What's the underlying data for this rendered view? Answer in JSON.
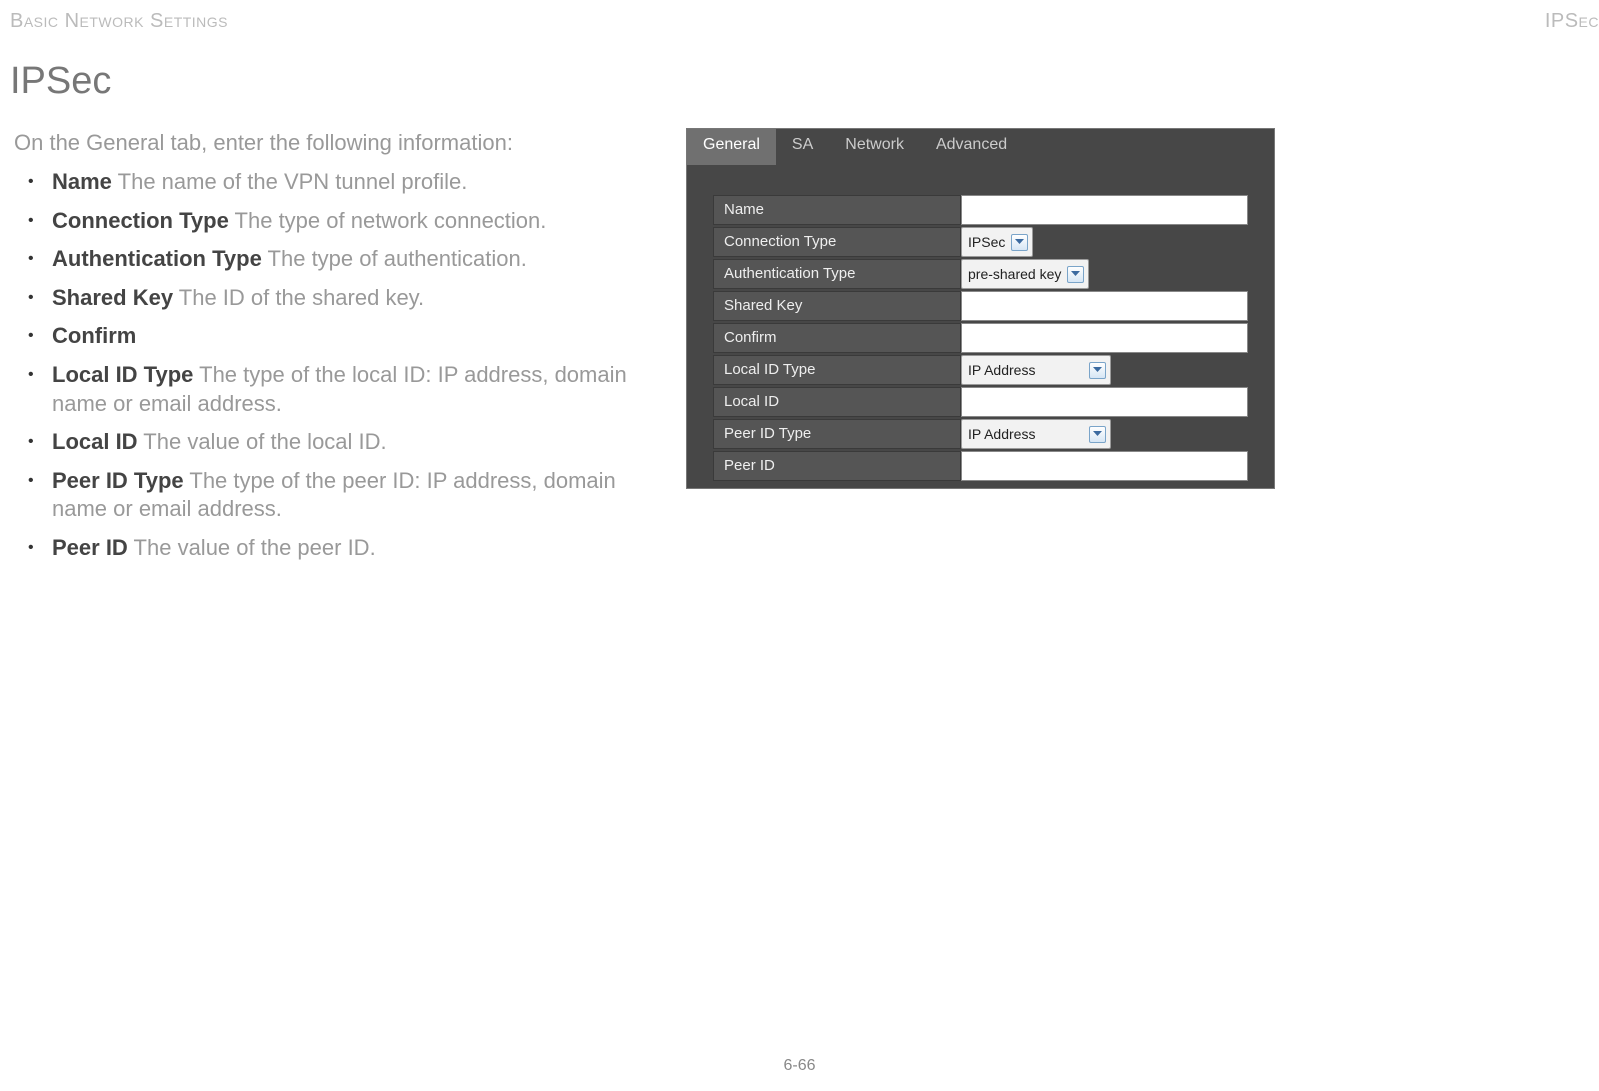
{
  "header": {
    "left": "Basic Network Settings",
    "right": "IPSec"
  },
  "section_title": "IPSec",
  "intro": "On the General tab, enter the following information:",
  "bullets": [
    {
      "term": "Name",
      "desc": "The name of the VPN tunnel profile."
    },
    {
      "term": "Connection Type",
      "desc": "The type of network connection."
    },
    {
      "term": "Authentication Type",
      "desc": "The type of authentication."
    },
    {
      "term": "Shared Key",
      "desc": "The ID of the shared key."
    },
    {
      "term": "Confirm",
      "desc": ""
    },
    {
      "term": "Local ID Type",
      "desc": "The type of the local ID: IP address, domain name or email address."
    },
    {
      "term": "Local ID",
      "desc": "The value of the local ID."
    },
    {
      "term": "Peer ID Type",
      "desc": "The type of the peer ID: IP address, domain name or email address."
    },
    {
      "term": "Peer ID",
      "desc": "The value of the peer ID."
    }
  ],
  "screenshot": {
    "tabs": [
      "General",
      "SA",
      "Network",
      "Advanced"
    ],
    "active_tab": "General",
    "form": {
      "name": {
        "label": "Name",
        "value": ""
      },
      "connection_type": {
        "label": "Connection Type",
        "value": "IPSec"
      },
      "authentication_type": {
        "label": "Authentication Type",
        "value": "pre-shared key"
      },
      "shared_key": {
        "label": "Shared Key",
        "value": ""
      },
      "confirm": {
        "label": "Confirm",
        "value": ""
      },
      "local_id_type": {
        "label": "Local ID Type",
        "value": "IP Address"
      },
      "local_id": {
        "label": "Local ID",
        "value": ""
      },
      "peer_id_type": {
        "label": "Peer ID Type",
        "value": "IP Address"
      },
      "peer_id": {
        "label": "Peer ID",
        "value": ""
      }
    }
  },
  "page_number": "6-66"
}
